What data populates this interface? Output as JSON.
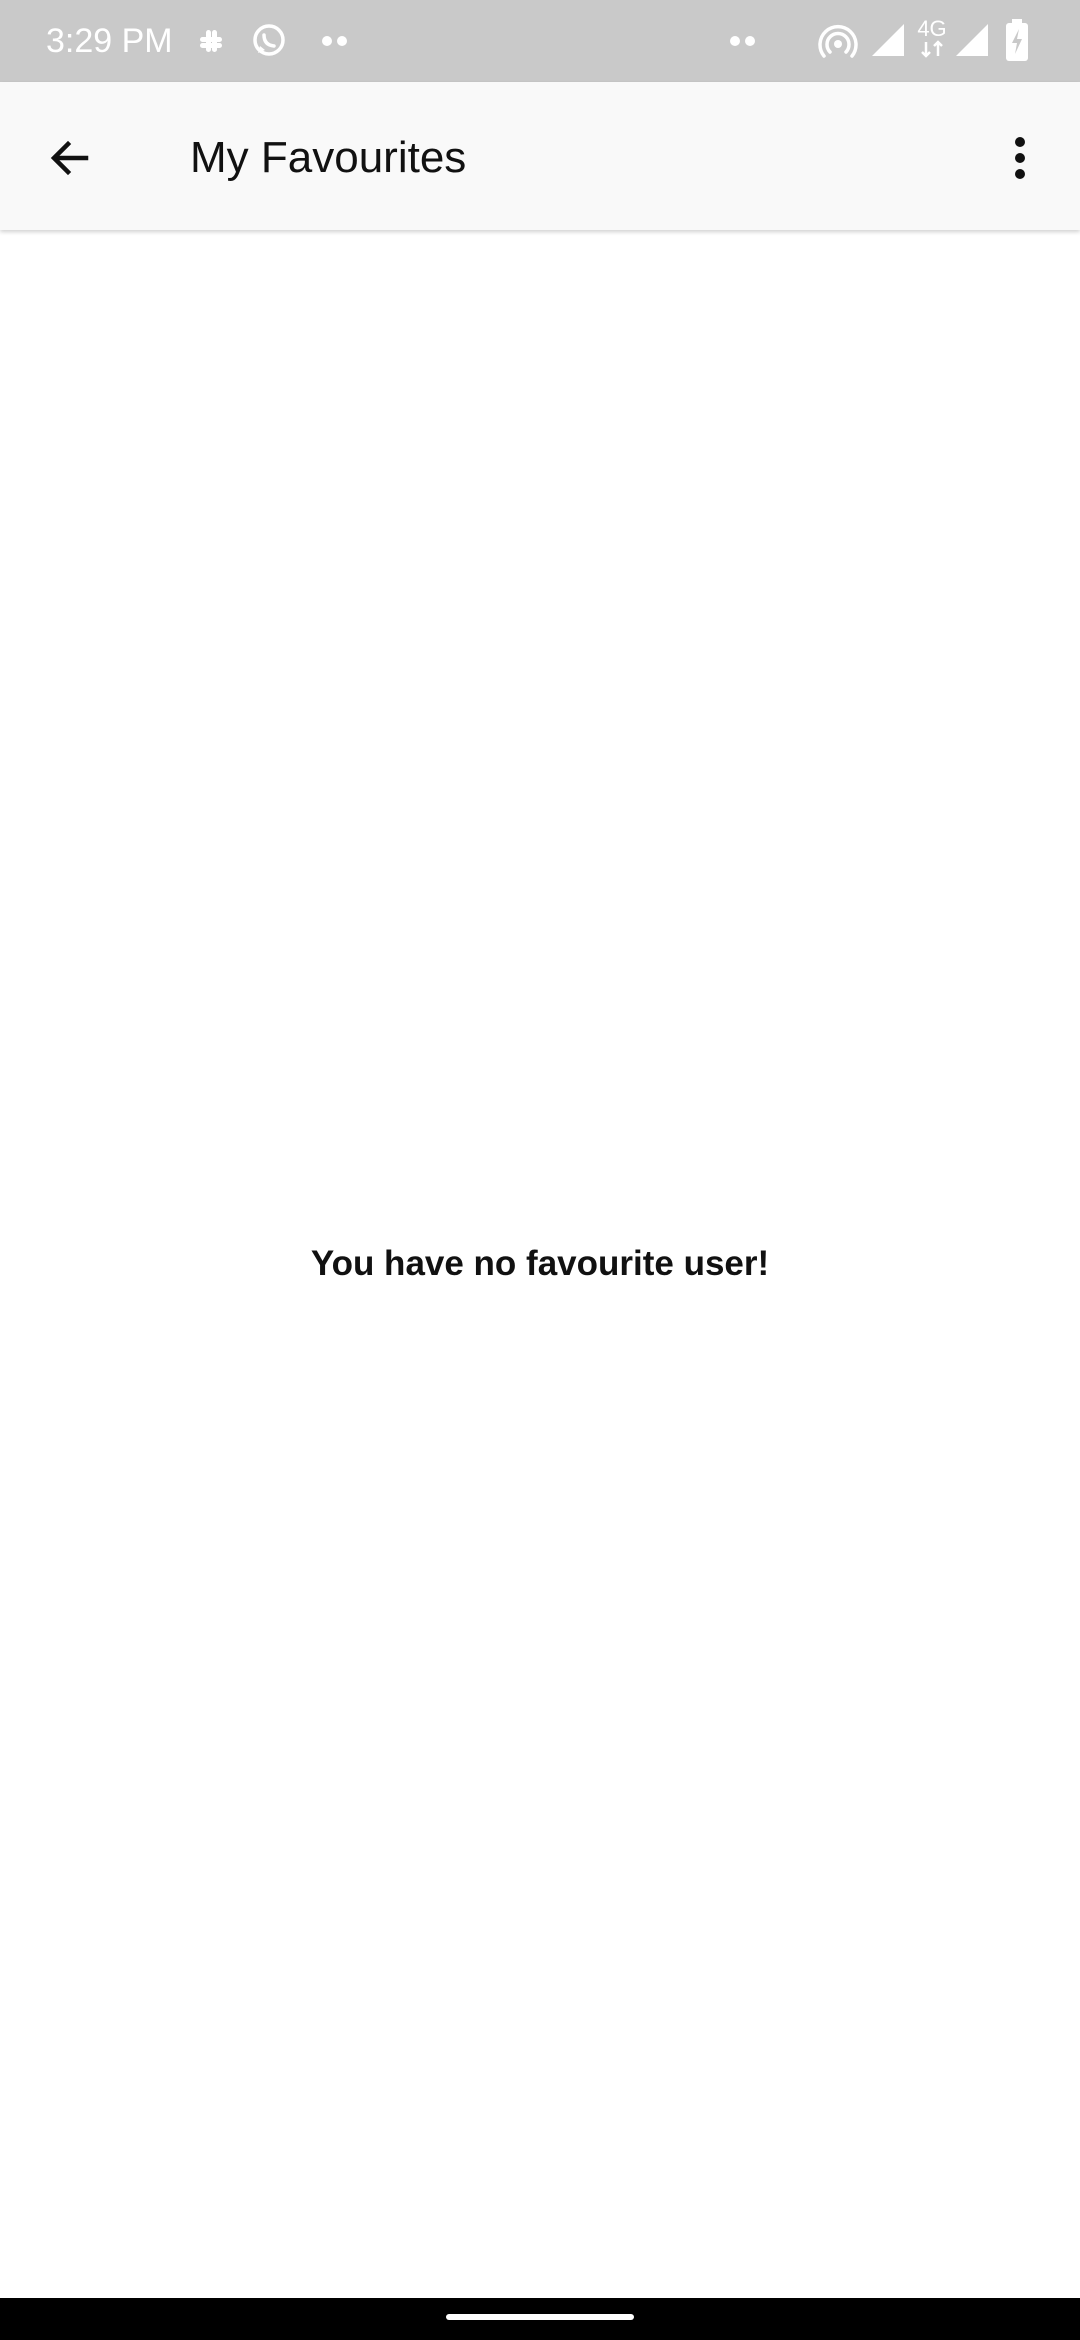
{
  "status_bar": {
    "time": "3:29 PM",
    "network_label": "4G",
    "left_icons": [
      "slack-icon",
      "whatsapp-icon",
      "more-notifications-icon"
    ],
    "right_icons": [
      "more-dots-icon",
      "hotspot-icon",
      "wifi-signal-icon",
      "cellular-4g-icon",
      "cellular-signal-icon",
      "battery-charging-icon"
    ]
  },
  "app_bar": {
    "title": "My Favourites",
    "back_icon": "arrow-back-icon",
    "menu_icon": "more-vert-icon"
  },
  "content": {
    "empty_message": "You have no favourite user!"
  },
  "colors": {
    "status_bar_bg": "#c9c9c9",
    "app_bar_bg": "#f9f9f9",
    "text_primary": "#111111",
    "nav_bar_bg": "#000000"
  }
}
